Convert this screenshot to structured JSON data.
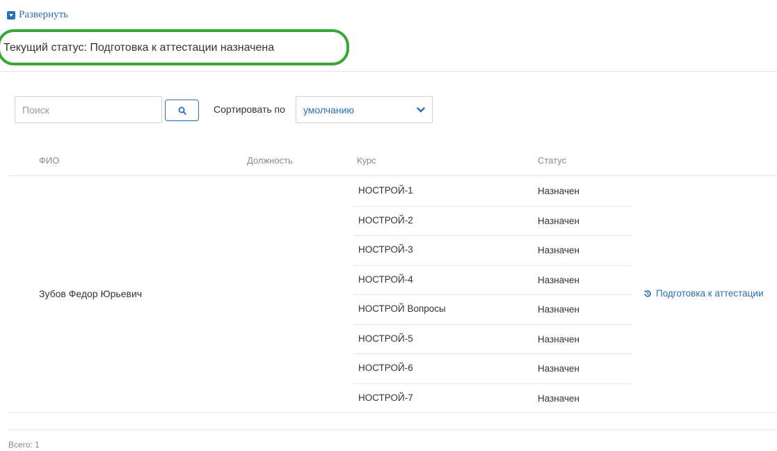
{
  "expand": {
    "label": "Развернуть",
    "icon": "expand-toggle-icon"
  },
  "current_status": {
    "text": "Текущий статус: Подготовка к аттестации назначена",
    "highlight_color": "#3aa63a"
  },
  "toolbar": {
    "search_placeholder": "Поиск",
    "search_icon": "search-icon",
    "sort_label": "Сортировать по",
    "sort_value": "умолчанию"
  },
  "table": {
    "headers": {
      "fio": "ФИО",
      "position": "Должность",
      "course": "Курс",
      "status": "Статус"
    },
    "person": {
      "fio": "Зубов Федор Юрьевич",
      "position": ""
    },
    "courses": [
      {
        "course": "НОСТРОЙ-1",
        "status": "Назначен"
      },
      {
        "course": "НОСТРОЙ-2",
        "status": "Назначен"
      },
      {
        "course": "НОСТРОЙ-3",
        "status": "Назначен"
      },
      {
        "course": "НОСТРОЙ-4",
        "status": "Назначен"
      },
      {
        "course": "НОСТРОЙ Вопросы",
        "status": "Назначен"
      },
      {
        "course": "НОСТРОЙ-5",
        "status": "Назначен"
      },
      {
        "course": "НОСТРОЙ-6",
        "status": "Назначен"
      },
      {
        "course": "НОСТРОЙ-7",
        "status": "Назначен"
      }
    ],
    "action": {
      "label": "Подготовка к аттестации",
      "icon": "history-icon"
    }
  },
  "footer": {
    "total": "Всего: 1"
  },
  "colors": {
    "accent": "#2a6fb5",
    "text": "#333333",
    "muted": "#8a8a8a",
    "divider": "#e6e6e6"
  }
}
